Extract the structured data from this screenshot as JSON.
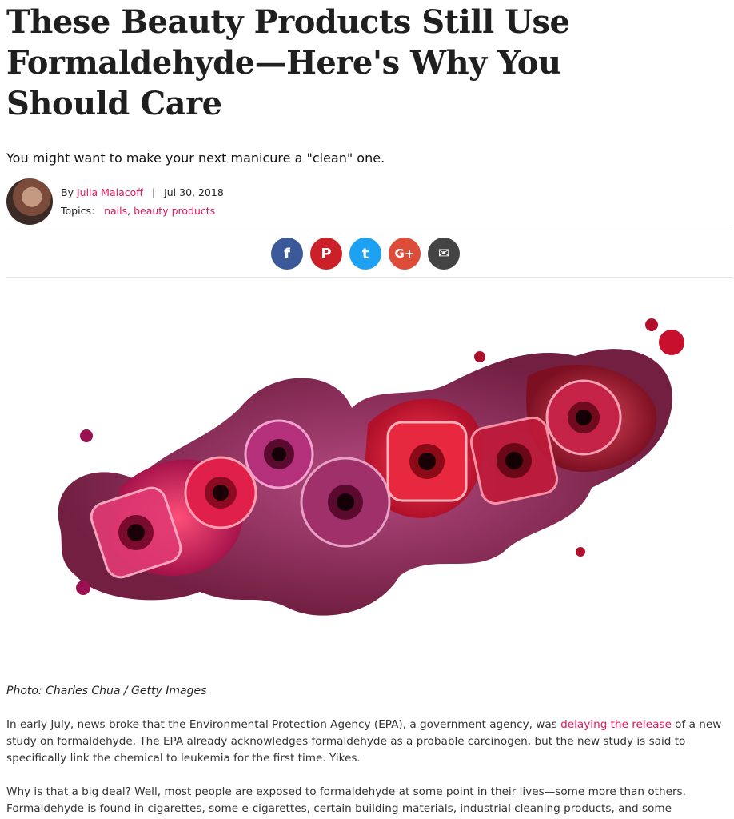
{
  "article": {
    "title": "These Beauty Products Still Use Formaldehyde—Here's Why You Should Care",
    "subtitle": "You might want to make your next manicure a \"clean\" one.",
    "byline": {
      "by": "By",
      "author": "Julia Malacoff",
      "separator": "|",
      "date": "Jul 30, 2018"
    },
    "topics": {
      "label": "Topics:",
      "items": [
        "nails",
        "beauty products"
      ]
    }
  },
  "share": [
    {
      "name": "facebook",
      "glyph": "f",
      "color": "#3b5998"
    },
    {
      "name": "pinterest",
      "glyph": "P",
      "color": "#cb2027"
    },
    {
      "name": "twitter",
      "glyph": "t",
      "color": "#1da1f2"
    },
    {
      "name": "google-plus",
      "glyph": "G+",
      "color": "#dd4b39"
    },
    {
      "name": "email",
      "glyph": "✉",
      "color": "#444444"
    }
  ],
  "photo": {
    "caption": "Photo: Charles Chua / Getty Images"
  },
  "body": {
    "p1_before": "In early July, news broke that the Environmental Protection Agency (EPA), a government agency, was ",
    "p1_link": "delaying the release",
    "p1_after": " of a new study on formaldehyde. The EPA already acknowledges formaldehyde as a probable carcinogen, but the new study is said to specifically link the chemical to leukemia for the first time. Yikes.",
    "p2": "Why is that a big deal? Well, most people are exposed to formaldehyde at some point in their lives—some more than others. Formaldehyde is found in cigarettes, some e-cigarettes, certain building materials, industrial cleaning products, and some"
  }
}
